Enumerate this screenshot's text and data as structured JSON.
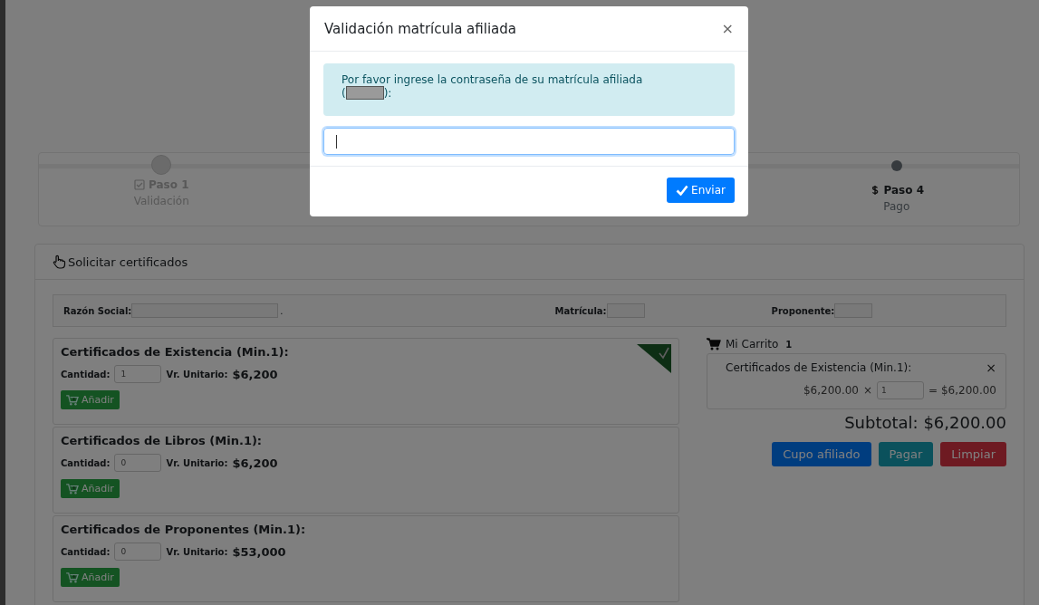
{
  "steps": [
    {
      "label": "Paso 1",
      "caption": "Validación",
      "completed": true
    },
    {
      "label": "Paso 4",
      "caption": "Pago",
      "completed": false
    }
  ],
  "panel": {
    "title": "Solicitar certificados"
  },
  "info": [
    {
      "label": "Razón Social:",
      "suffix": "."
    },
    {
      "label": "Matrícula:"
    },
    {
      "label": "Proponente:"
    }
  ],
  "products": [
    {
      "title": "Certificados de Existencia (Min.1):",
      "qty_label": "Cantidad:",
      "qty": "1",
      "price_label": "Vr. Unitario:",
      "price": "$6,200",
      "button": "Añadir",
      "in_cart": true
    },
    {
      "title": "Certificados de Libros (Min.1):",
      "qty_label": "Cantidad:",
      "qty": "0",
      "price_label": "Vr. Unitario:",
      "price": "$6,200",
      "button": "Añadir",
      "in_cart": false
    },
    {
      "title": "Certificados de Proponentes (Min.1):",
      "qty_label": "Cantidad:",
      "qty": "0",
      "price_label": "Vr. Unitario:",
      "price": "$53,000",
      "button": "Añadir",
      "in_cart": false
    }
  ],
  "cart": {
    "title": "Mi Carrito",
    "count": "1",
    "items": [
      {
        "name": "Certificados de Existencia (Min.1):",
        "close": "×",
        "price": "$6,200.00",
        "times": "×",
        "qty": "1",
        "total": "= $6,200.00"
      }
    ],
    "subtotal": "Subtotal: $6,200.00",
    "buttons": [
      {
        "label": "Cupo afiliado",
        "kind": "primary"
      },
      {
        "label": "Pagar",
        "kind": "info"
      },
      {
        "label": "Limpiar",
        "kind": "danger"
      }
    ]
  },
  "modal": {
    "title": "Validación matrícula afiliada",
    "close": "×",
    "message": "Por favor ingrese la contraseña de su matrícula afiliada",
    "message_open": "(",
    "message_close": "):",
    "submit": "Enviar"
  }
}
